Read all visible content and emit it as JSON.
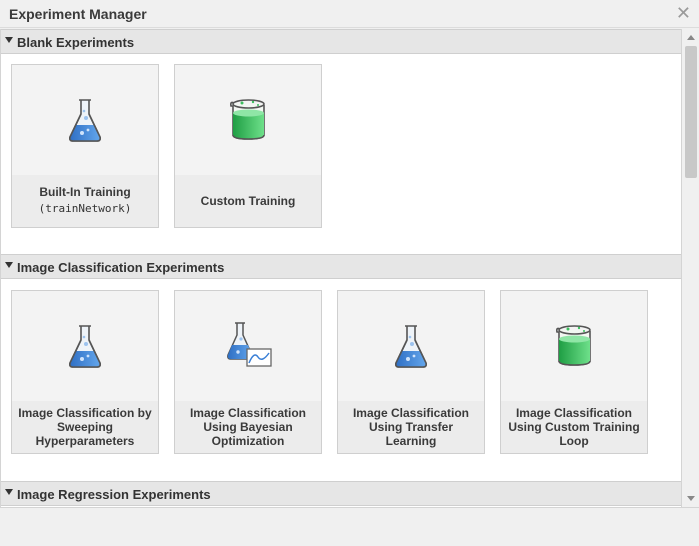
{
  "window": {
    "title": "Experiment Manager",
    "close_glyph": "✕"
  },
  "sections": [
    {
      "label": "Blank Experiments"
    },
    {
      "label": "Image Classification Experiments"
    },
    {
      "label": "Image Regression Experiments"
    }
  ],
  "blank_tiles": [
    {
      "caption": "Built-In Training",
      "caption2": "(trainNetwork)",
      "icon": "flask-icon"
    },
    {
      "caption": "Custom Training",
      "icon": "beaker-icon"
    }
  ],
  "image_classification_tiles": [
    {
      "caption": "Image Classification by Sweeping Hyperparameters",
      "icon": "flask-icon"
    },
    {
      "caption": "Image Classification Using Bayesian Optimization",
      "icon": "flask-with-chart-icon"
    },
    {
      "caption": "Image Classification Using Transfer Learning",
      "icon": "flask-icon"
    },
    {
      "caption": "Image Classification Using Custom Training Loop",
      "icon": "beaker-icon"
    }
  ],
  "colors": {
    "flask_liquid": "#3a7fd6",
    "beaker_liquid": "#2ecc5a",
    "section_header": "#e6e6e6"
  }
}
